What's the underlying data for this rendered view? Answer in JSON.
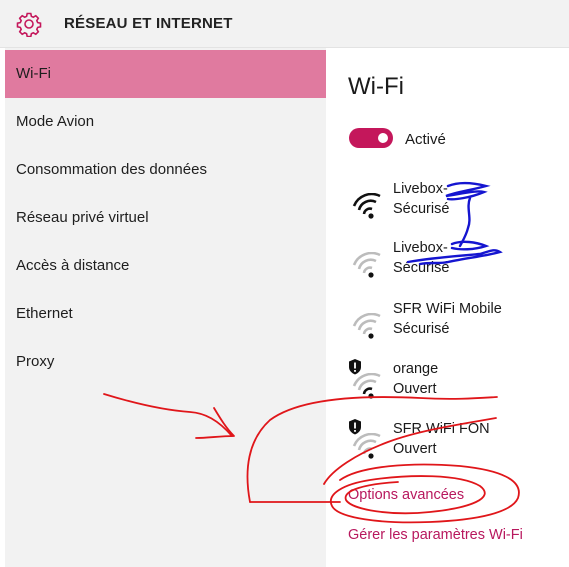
{
  "header": {
    "title": "RÉSEAU ET INTERNET",
    "icon": "gear-icon"
  },
  "sidebar": {
    "items": [
      {
        "label": "Wi-Fi",
        "active": true
      },
      {
        "label": "Mode Avion"
      },
      {
        "label": "Consommation des données"
      },
      {
        "label": "Réseau privé virtuel"
      },
      {
        "label": "Accès à distance"
      },
      {
        "label": "Ethernet"
      },
      {
        "label": "Proxy"
      }
    ]
  },
  "main": {
    "title": "Wi-Fi",
    "toggle": {
      "label": "Activé",
      "state": "on"
    },
    "networks": [
      {
        "name": "Livebox-",
        "status": "Sécurisé",
        "signal": "full",
        "secured": true
      },
      {
        "name": "Livebox-",
        "status": "Sécurisé",
        "signal": "weak",
        "secured": true
      },
      {
        "name": "SFR WiFi Mobile",
        "status": "Sécurisé",
        "signal": "weak",
        "secured": true
      },
      {
        "name": "orange",
        "status": "Ouvert",
        "signal": "weak",
        "secured": false
      },
      {
        "name": "SFR WiFi FON",
        "status": "Ouvert",
        "signal": "weak",
        "secured": false
      }
    ],
    "links": {
      "advanced": "Options avancées",
      "manage": "Gérer les paramètres Wi-Fi"
    }
  },
  "colors": {
    "accent": "#c4175b",
    "link": "#b8185e",
    "sidebar_active": "#e07a9f",
    "sidebar_bg": "#f2f2f2",
    "annotation_red": "#e0161a",
    "annotation_blue": "#1515d0"
  }
}
